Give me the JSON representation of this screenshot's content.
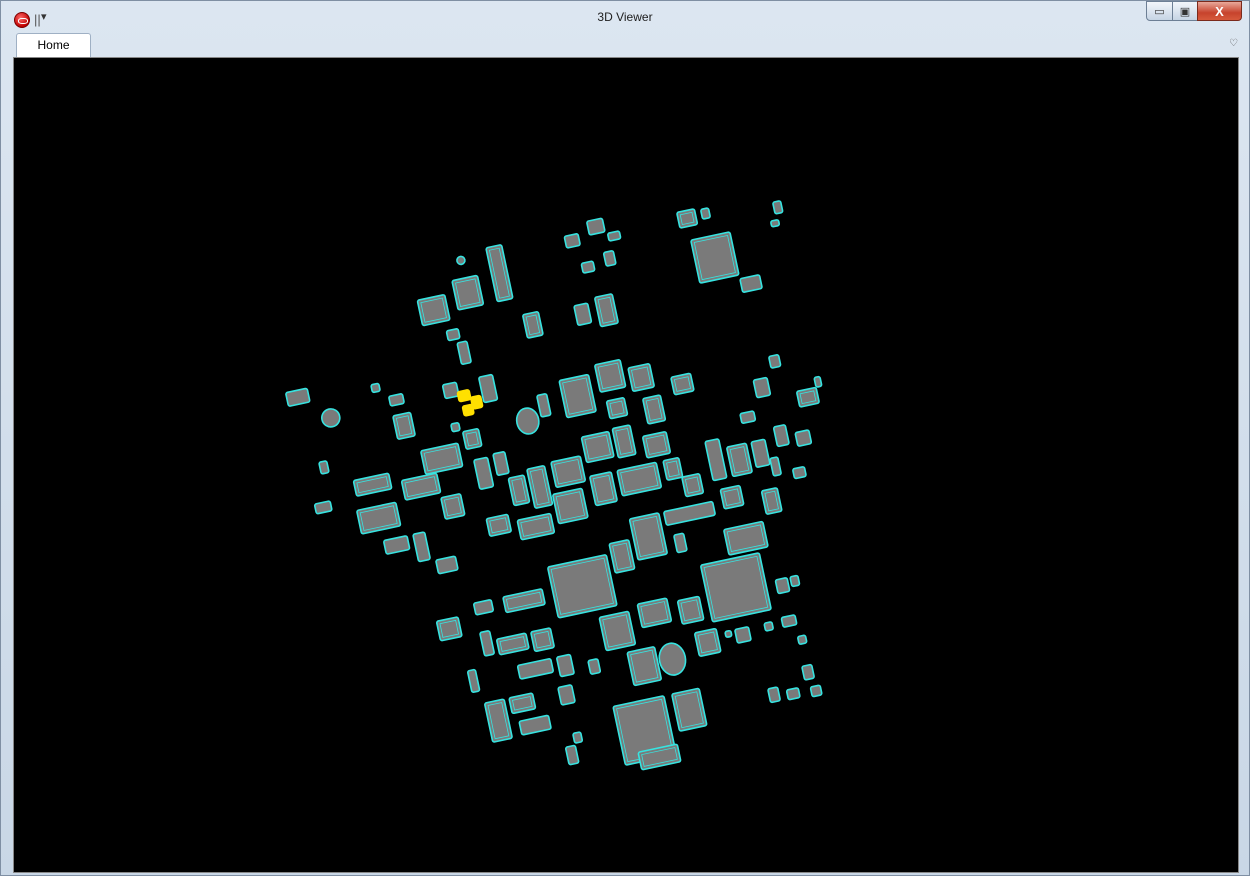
{
  "window": {
    "title": "3D Viewer",
    "qat_separator": "||",
    "qat_dropdown": "▾",
    "controls": {
      "minimize": "▭",
      "maximize": "▣",
      "close": "X"
    }
  },
  "ribbon": {
    "tabs": [
      {
        "label": "Home",
        "active": true
      }
    ],
    "collapse_toggle": "♡"
  },
  "viewport": {
    "background": "#000000",
    "outline_color": "#37e3e0",
    "fill_color": "#7a7a7a",
    "highlight_color": "#ffe000"
  }
}
